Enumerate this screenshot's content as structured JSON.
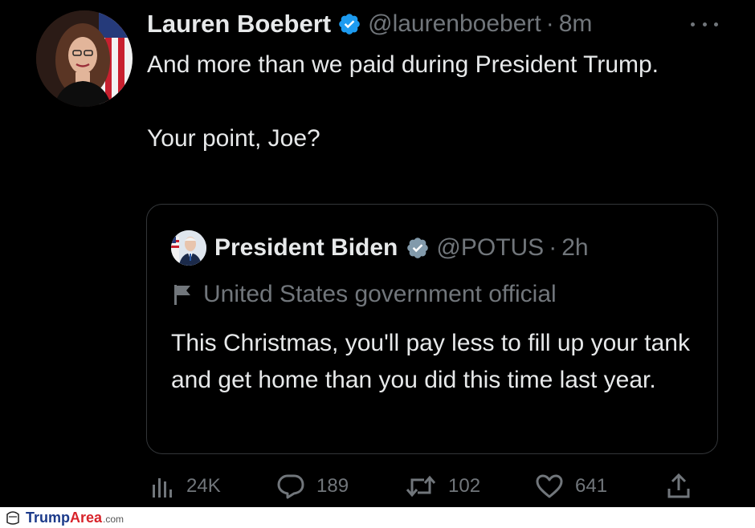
{
  "tweet": {
    "author": {
      "name": "Lauren Boebert",
      "handle": "@laurenboebert",
      "separator": "·",
      "time": "8m",
      "verified_icon": "verified-badge-icon"
    },
    "text_lines": [
      "And more than we paid during President Trump.",
      "Your point, Joe?"
    ],
    "quoted": {
      "name": "President Biden",
      "handle": "@POTUS",
      "separator": "·",
      "time": "2h",
      "label": "United States government official",
      "text": "This Christmas, you'll pay less to fill up your tank and get home than you did this time last year."
    },
    "actions": {
      "views": "24K",
      "replies": "189",
      "retweets": "102",
      "likes": "641"
    }
  },
  "watermark": {
    "part1": "Trump",
    "part2": "Area",
    "part3": ".com"
  },
  "colors": {
    "background": "#000000",
    "text": "#e7e9ea",
    "muted": "#71767b",
    "verified_blue": "#1d9bf0",
    "verified_gray": "#829aab",
    "border": "#333639"
  }
}
